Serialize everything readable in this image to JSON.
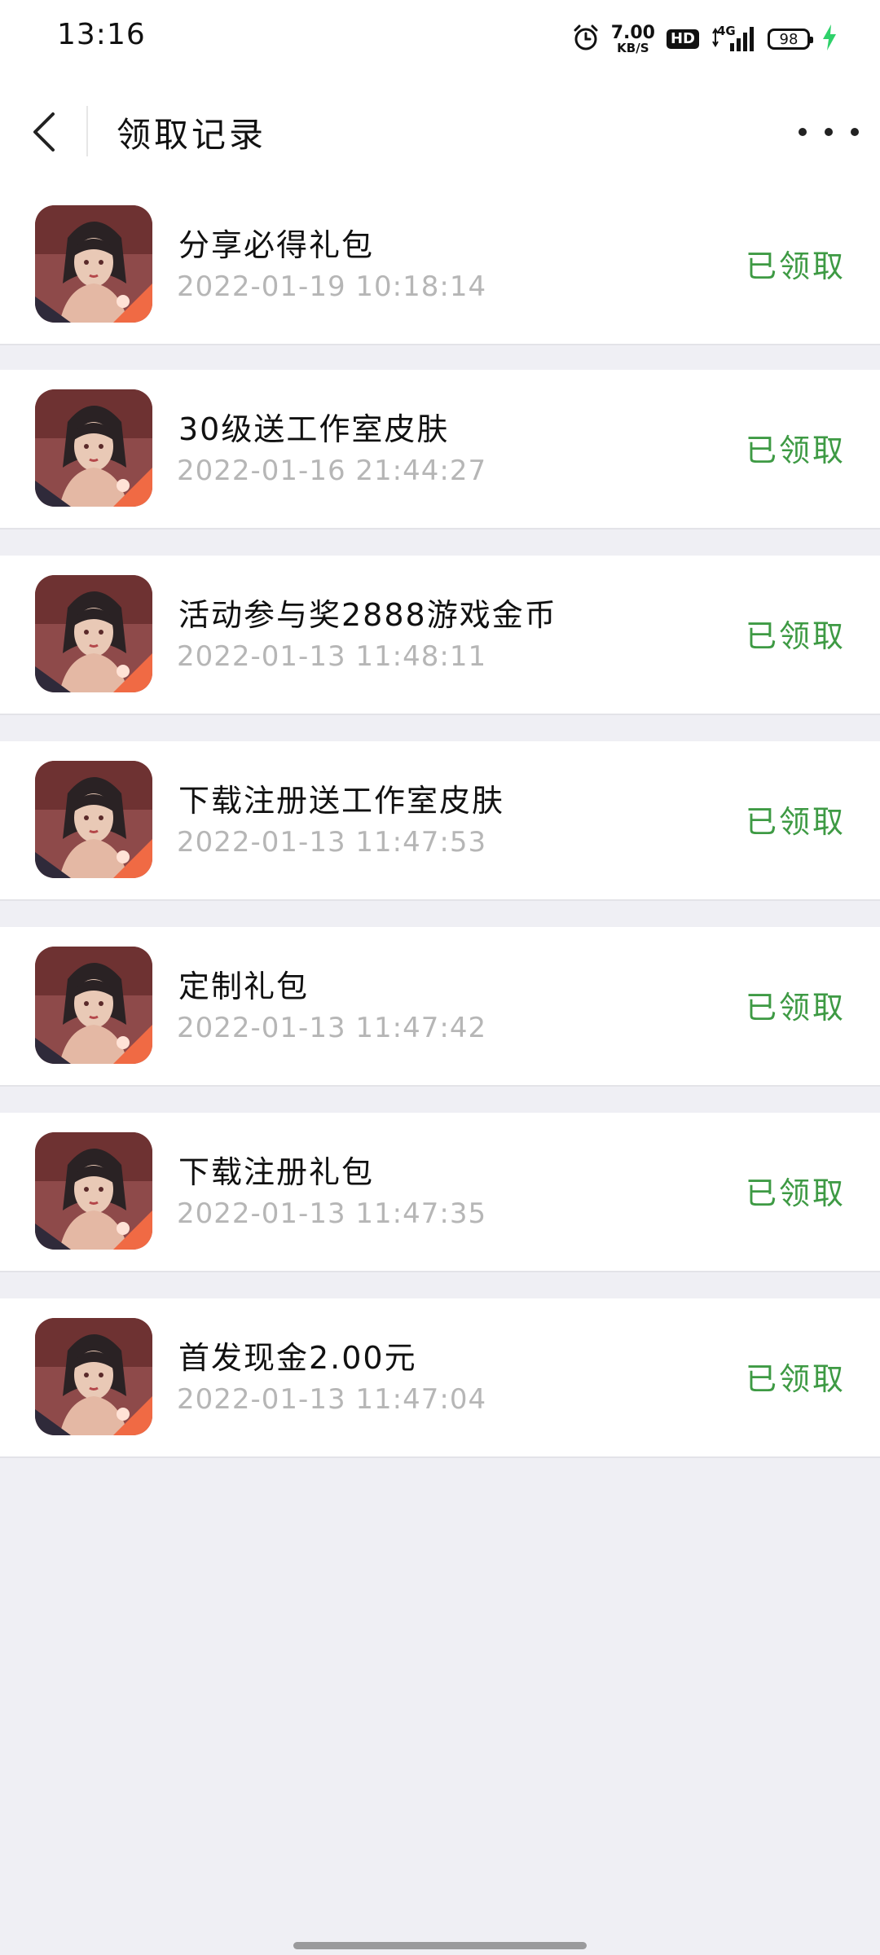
{
  "status_bar": {
    "time": "13:16",
    "net_speed_value": "7.00",
    "net_speed_unit": "KB/S",
    "hd_label": "HD",
    "network_label": "4G",
    "battery_level": "98",
    "charging": true,
    "icons": [
      "alarm-icon",
      "hd-icon",
      "signal-icon",
      "battery-icon",
      "charging-icon"
    ]
  },
  "header": {
    "title": "领取记录",
    "back_icon": "back-arrow-icon",
    "more_icon": "more-dots-icon"
  },
  "records": [
    {
      "name": "分享必得礼包",
      "time": "2022-01-19 10:18:14",
      "status": "已领取"
    },
    {
      "name": "30级送工作室皮肤",
      "time": "2022-01-16 21:44:27",
      "status": "已领取"
    },
    {
      "name": "活动参与奖2888游戏金币",
      "time": "2022-01-13 11:48:11",
      "status": "已领取"
    },
    {
      "name": "下载注册送工作室皮肤",
      "time": "2022-01-13 11:47:53",
      "status": "已领取"
    },
    {
      "name": "定制礼包",
      "time": "2022-01-13 11:47:42",
      "status": "已领取"
    },
    {
      "name": "下载注册礼包",
      "time": "2022-01-13 11:47:35",
      "status": "已领取"
    },
    {
      "name": "首发现金2.00元",
      "time": "2022-01-13 11:47:04",
      "status": "已领取"
    }
  ],
  "colors": {
    "status_green": "#3e9a44",
    "time_gray": "#b6b6b6",
    "background": "#efeff4",
    "charging_green": "#2fd16a"
  }
}
